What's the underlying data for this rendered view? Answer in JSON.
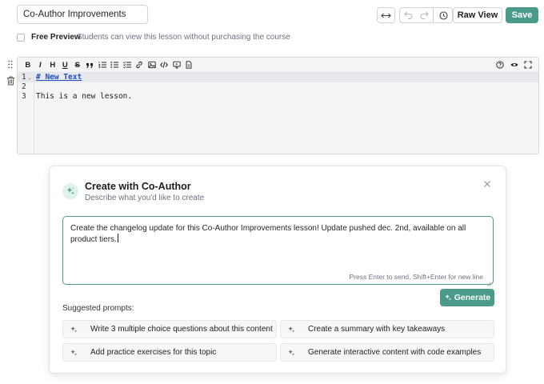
{
  "header": {
    "lesson_title": "Co-Author Improvements",
    "raw_view_label": "Raw View",
    "save_label": "Save"
  },
  "free_preview": {
    "label": "Free Preview",
    "description": "Students can view this lesson without purchasing the course",
    "checked": false
  },
  "editor": {
    "lines": [
      {
        "number": "1",
        "text": "# New Text"
      },
      {
        "number": "2",
        "text": ""
      },
      {
        "number": "3",
        "text": "This is a new lesson."
      }
    ]
  },
  "coauthor": {
    "title": "Create with Co-Author",
    "subtitle": "Describe what you'd like to create",
    "prompt_value": "Create the changelog update for this Co-Author Improvements lesson! Update pushed dec. 2nd, available on all product tiers.",
    "hint": "Press Enter to send, Shift+Enter for new line",
    "generate_label": "Generate",
    "suggested_label": "Suggested prompts:",
    "suggestions": [
      "Write 3 multiple choice questions about this content",
      "Create a summary with key takeaways",
      "Add practice exercises for this topic",
      "Generate interactive content with code examples"
    ]
  },
  "colors": {
    "accent": "#4a9a8a",
    "link": "#1f4fbf"
  }
}
